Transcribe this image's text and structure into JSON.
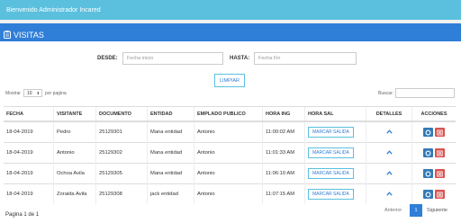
{
  "topbar": {
    "welcome": "Bienvenido Administrador Incared"
  },
  "panel": {
    "title": "VISITAS",
    "icon": "clipboard-icon"
  },
  "filters": {
    "desde_label": "DESDE:",
    "desde_placeholder": "Fecha inicio",
    "hasta_label": "HASTA:",
    "hasta_placeholder": "Fecha Fin",
    "clear_label": "LIMPIAR"
  },
  "length": {
    "prefix": "Mostrar",
    "value": "10",
    "suffix": "por pagina"
  },
  "search": {
    "label": "Buscar:"
  },
  "table": {
    "headers": [
      "FECHA",
      "VISITANTE",
      "DOCUMENTO",
      "ENTIDAD",
      "EMPLADO PUBLICO",
      "HORA ING",
      "HORA SAL",
      "DETALLES",
      "ACCIONES"
    ],
    "rows": [
      {
        "fecha": "18-04-2019",
        "visitante": "Pedro",
        "documento": "25129301",
        "entidad": "Mana entidad",
        "empleado": "Antonio",
        "hora_ing": "11:00:02 AM",
        "hora_sal": "MARCAR SALIDA"
      },
      {
        "fecha": "18-04-2019",
        "visitante": "Antonio",
        "documento": "25129302",
        "entidad": "Mana entidad",
        "empleado": "Antonio",
        "hora_ing": "11:01:33 AM",
        "hora_sal": "MARCAR SALIDA"
      },
      {
        "fecha": "18-04-2019",
        "visitante": "Ochoa Avila",
        "documento": "25129305",
        "entidad": "Mana entidad",
        "empleado": "Antonio",
        "hora_ing": "11:06:10 AM",
        "hora_sal": "MARCAR SALIDA"
      },
      {
        "fecha": "18-04-2019",
        "visitante": "Zoraida Avila",
        "documento": "25129308",
        "entidad": "jack entidad",
        "empleado": "Antonio",
        "hora_ing": "11:07:15 AM",
        "hora_sal": "MARCAR SALIDA"
      }
    ]
  },
  "pagination": {
    "info": "Pagina 1 de 1",
    "prev": "Anterior",
    "current": "1",
    "next": "Siguiente"
  },
  "colors": {
    "topbar": "#5bc0de",
    "header": "#2f7ed8",
    "view": "#337ab7",
    "delete": "#d9534f"
  }
}
